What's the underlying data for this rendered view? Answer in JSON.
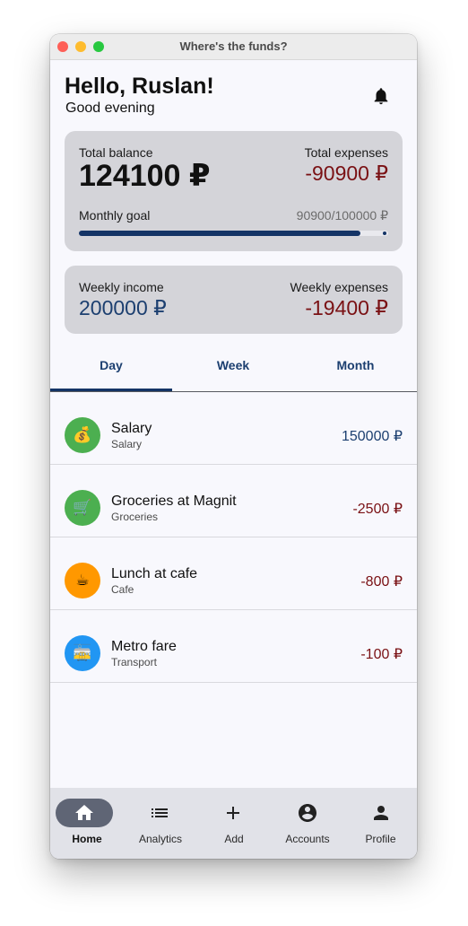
{
  "window": {
    "title": "Where's the funds?"
  },
  "header": {
    "greeting": "Hello, Ruslan!",
    "subtitle": "Good evening",
    "notification_icon": "bell-icon"
  },
  "summary": {
    "total_balance_label": "Total balance",
    "total_balance": "124100 ₽",
    "total_expenses_label": "Total expenses",
    "total_expenses": "-90900 ₽",
    "goal_label": "Monthly goal",
    "goal_value": "90900/100000 ₽",
    "goal_progress": 0.909
  },
  "weekly": {
    "income_label": "Weekly income",
    "income": "200000 ₽",
    "expenses_label": "Weekly expenses",
    "expenses": "-19400 ₽"
  },
  "tabs": [
    {
      "label": "Day",
      "active": true
    },
    {
      "label": "Week",
      "active": false
    },
    {
      "label": "Month",
      "active": false
    }
  ],
  "transactions": [
    {
      "title": "Salary",
      "category": "Salary",
      "amount": "150000 ₽",
      "icon": "money-bag-icon",
      "emoji": "💰",
      "color": "#4caf50",
      "amount_color": "#1c3f70"
    },
    {
      "title": "Groceries at Magnit",
      "category": "Groceries",
      "amount": "-2500 ₽",
      "icon": "shopping-cart-icon",
      "emoji": "🛒",
      "color": "#4caf50",
      "amount_color": "#7a1114"
    },
    {
      "title": "Lunch at cafe",
      "category": "Cafe",
      "amount": "-800 ₽",
      "icon": "coffee-icon",
      "emoji": "☕",
      "color": "#ff9800",
      "amount_color": "#7a1114"
    },
    {
      "title": "Metro fare",
      "category": "Transport",
      "amount": "-100 ₽",
      "icon": "tram-icon",
      "emoji": "🚋",
      "color": "#2196f3",
      "amount_color": "#7a1114"
    }
  ],
  "nav": [
    {
      "label": "Home",
      "icon": "home-icon",
      "active": true
    },
    {
      "label": "Analytics",
      "icon": "list-icon",
      "active": false
    },
    {
      "label": "Add",
      "icon": "plus-icon",
      "active": false
    },
    {
      "label": "Accounts",
      "icon": "account-circle-icon",
      "active": false
    },
    {
      "label": "Profile",
      "icon": "person-icon",
      "active": false
    }
  ],
  "colors": {
    "accent": "#143466",
    "income": "#1c3f70",
    "expense": "#7a1114",
    "card": "#d4d4d9"
  }
}
